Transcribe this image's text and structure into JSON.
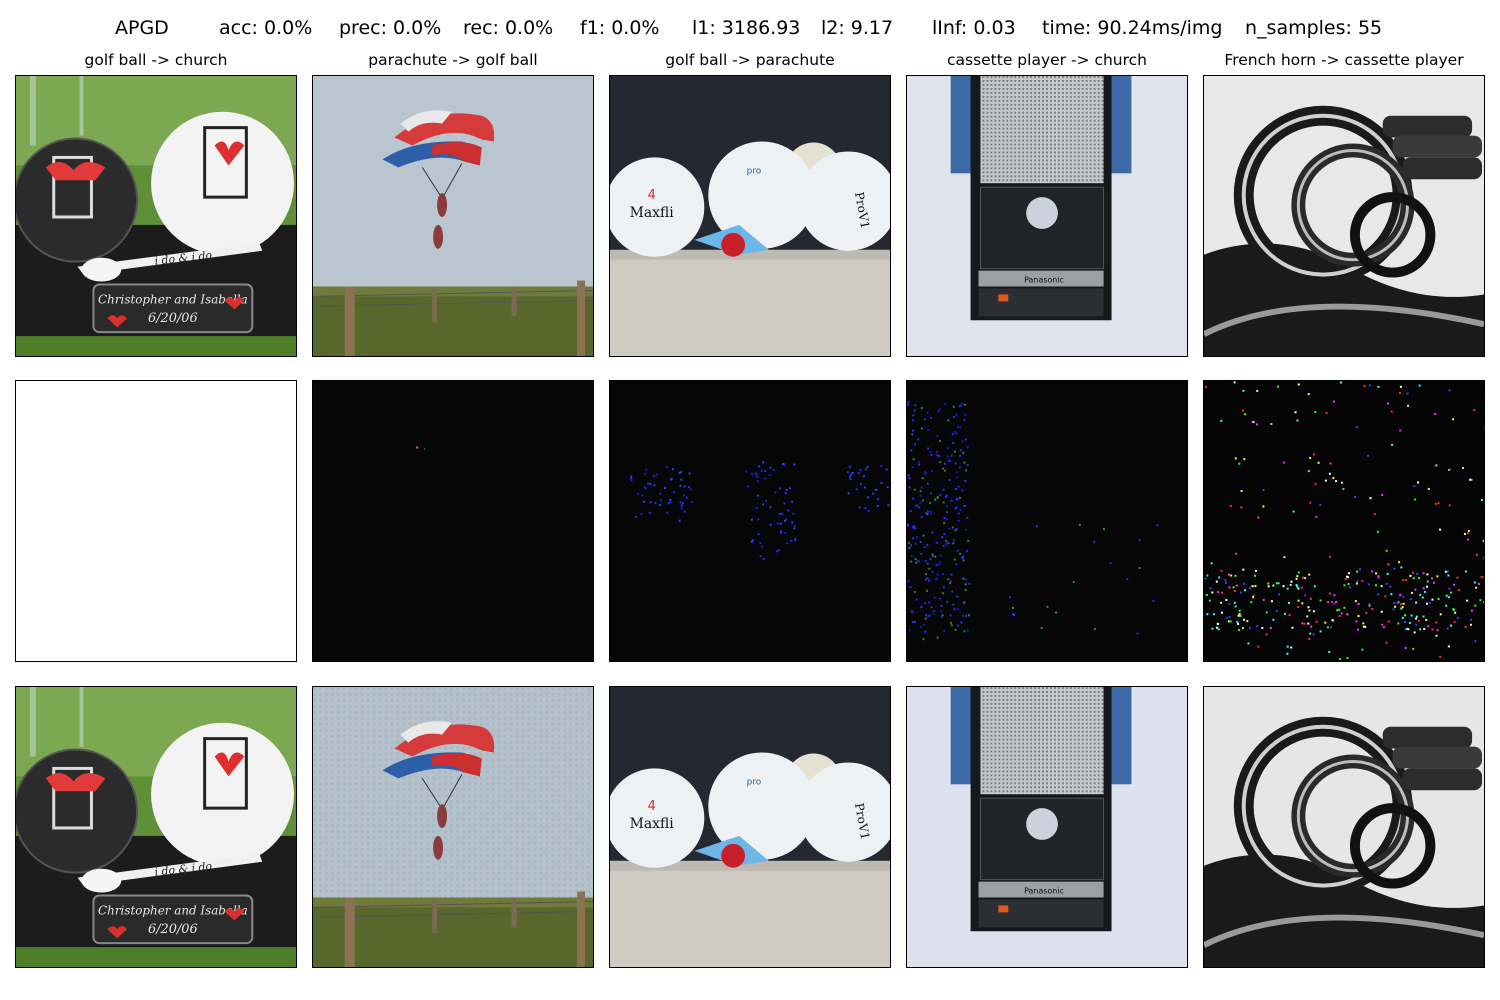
{
  "figure": {
    "stats": {
      "method": "APGD",
      "acc": "acc: 0.0%",
      "prec": "prec: 0.0%",
      "rec": "rec: 0.0%",
      "f1": "f1: 0.0%",
      "l1": "l1: 3186.93",
      "l2": "l2: 9.17",
      "linf": "lInf: 0.03",
      "time": "time: 90.24ms/img",
      "n_samples": "n_samples: 55"
    },
    "columns": [
      {
        "title": "golf ball -> church",
        "subject": "golf-balls-with-tee-and-name-plaque"
      },
      {
        "title": "parachute -> golf ball",
        "subject": "tandem-parachute-over-field"
      },
      {
        "title": "golf ball -> parachute",
        "subject": "three-golf-balls-with-tees"
      },
      {
        "title": "cassette player -> church",
        "subject": "panasonic-cassette-player"
      },
      {
        "title": "French horn -> cassette player",
        "subject": "french-horn-grayscale"
      }
    ],
    "rows": [
      "original",
      "perturbation",
      "adversarial"
    ],
    "image_text": {
      "plaque_line1": "Christopher and Isabella",
      "plaque_date": "6/20/06",
      "tee_text": "i do & i do",
      "ball_brand": "Maxfli",
      "ball_brand2": "ProV1",
      "cassette_brand": "Panasonic"
    }
  }
}
